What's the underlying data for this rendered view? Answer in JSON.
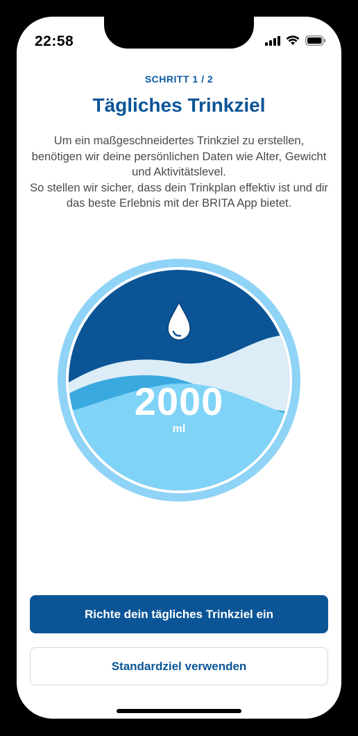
{
  "status_bar": {
    "time": "22:58"
  },
  "header": {
    "step": "SCHRITT 1 / 2",
    "title": "Tägliches Trinkziel"
  },
  "description": {
    "paragraph1": "Um ein maßgeschneidertes Trinkziel zu erstellen, benötigen wir deine persönlichen Daten wie Alter, Gewicht und Aktivitätslevel.",
    "paragraph2": "So stellen wir sicher, dass dein Trinkplan effektiv ist und dir das beste Erlebnis mit der BRITA App bietet."
  },
  "gauge": {
    "value": "2000",
    "unit": "ml",
    "icon": "water-drop-icon"
  },
  "buttons": {
    "primary_label": "Richte dein tägliches Trinkziel ein",
    "secondary_label": "Standardziel verwenden"
  },
  "colors": {
    "brand_blue": "#0b5597",
    "light_blue": "#7fd3f7",
    "ring_blue": "#8fd3f6"
  }
}
